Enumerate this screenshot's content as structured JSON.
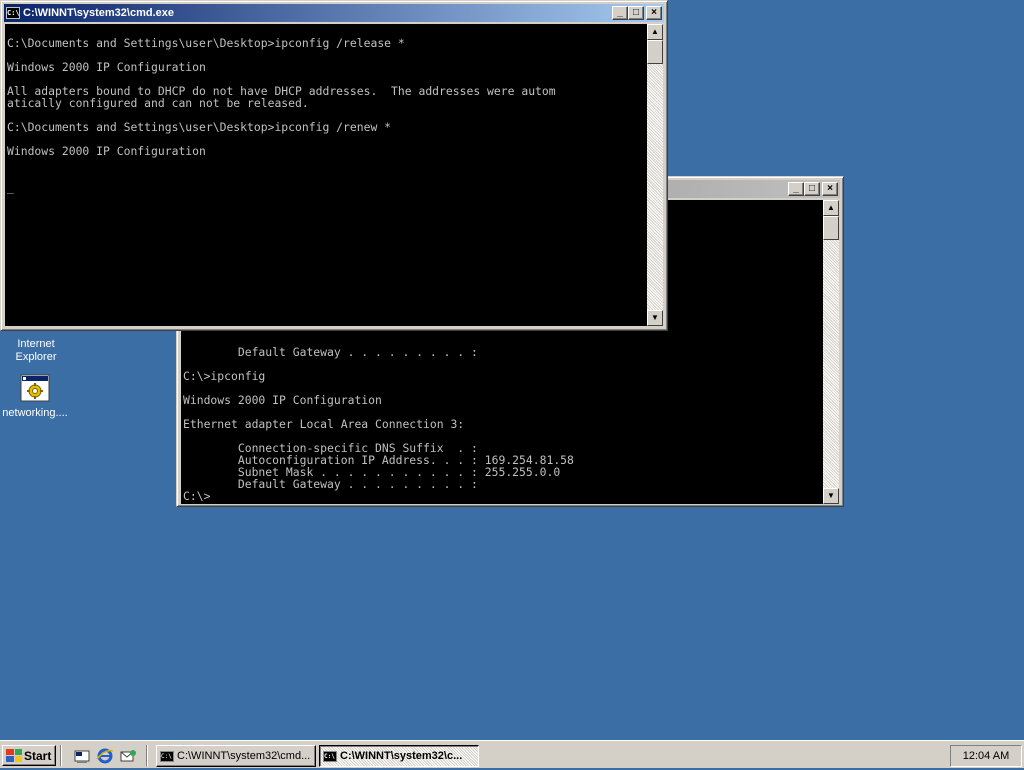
{
  "desktop": {
    "icons": [
      {
        "label": "Internet Explorer",
        "icon": "internet-explorer-icon"
      },
      {
        "label": "networking....",
        "icon": "network-setup-icon"
      }
    ],
    "background": "#3a6ea5"
  },
  "windows": {
    "front": {
      "title": "C:\\WINNT\\system32\\cmd.exe",
      "active": true,
      "lines": [
        "C:\\Documents and Settings\\user\\Desktop>ipconfig /release *",
        "",
        "Windows 2000 IP Configuration",
        "",
        "All adapters bound to DHCP do not have DHCP addresses.  The addresses were autom",
        "atically configured and can not be released.",
        "",
        "C:\\Documents and Settings\\user\\Desktop>ipconfig /renew *",
        "",
        "Windows 2000 IP Configuration",
        "",
        "",
        "_"
      ]
    },
    "back": {
      "title": "",
      "active": false,
      "lines": [
        "        Default Gateway . . . . . . . . . :",
        "",
        "C:\\>ipconfig",
        "",
        "Windows 2000 IP Configuration",
        "",
        "Ethernet adapter Local Area Connection 3:",
        "",
        "        Connection-specific DNS Suffix  . :",
        "        Autoconfiguration IP Address. . . : 169.254.81.58",
        "        Subnet Mask . . . . . . . . . . . : 255.255.0.0",
        "        Default Gateway . . . . . . . . . :",
        "C:\\>"
      ]
    },
    "caption_buttons": {
      "minimize": "_",
      "maximize": "□",
      "close": "×"
    }
  },
  "taskbar": {
    "start_label": "Start",
    "quick_launch": [
      "show-desktop-icon",
      "internet-explorer-icon",
      "outlook-express-icon"
    ],
    "tasks": [
      {
        "label": "C:\\WINNT\\system32\\cmd...",
        "pressed": false
      },
      {
        "label": "C:\\WINNT\\system32\\c...",
        "pressed": true
      }
    ],
    "clock": "12:04 AM"
  }
}
